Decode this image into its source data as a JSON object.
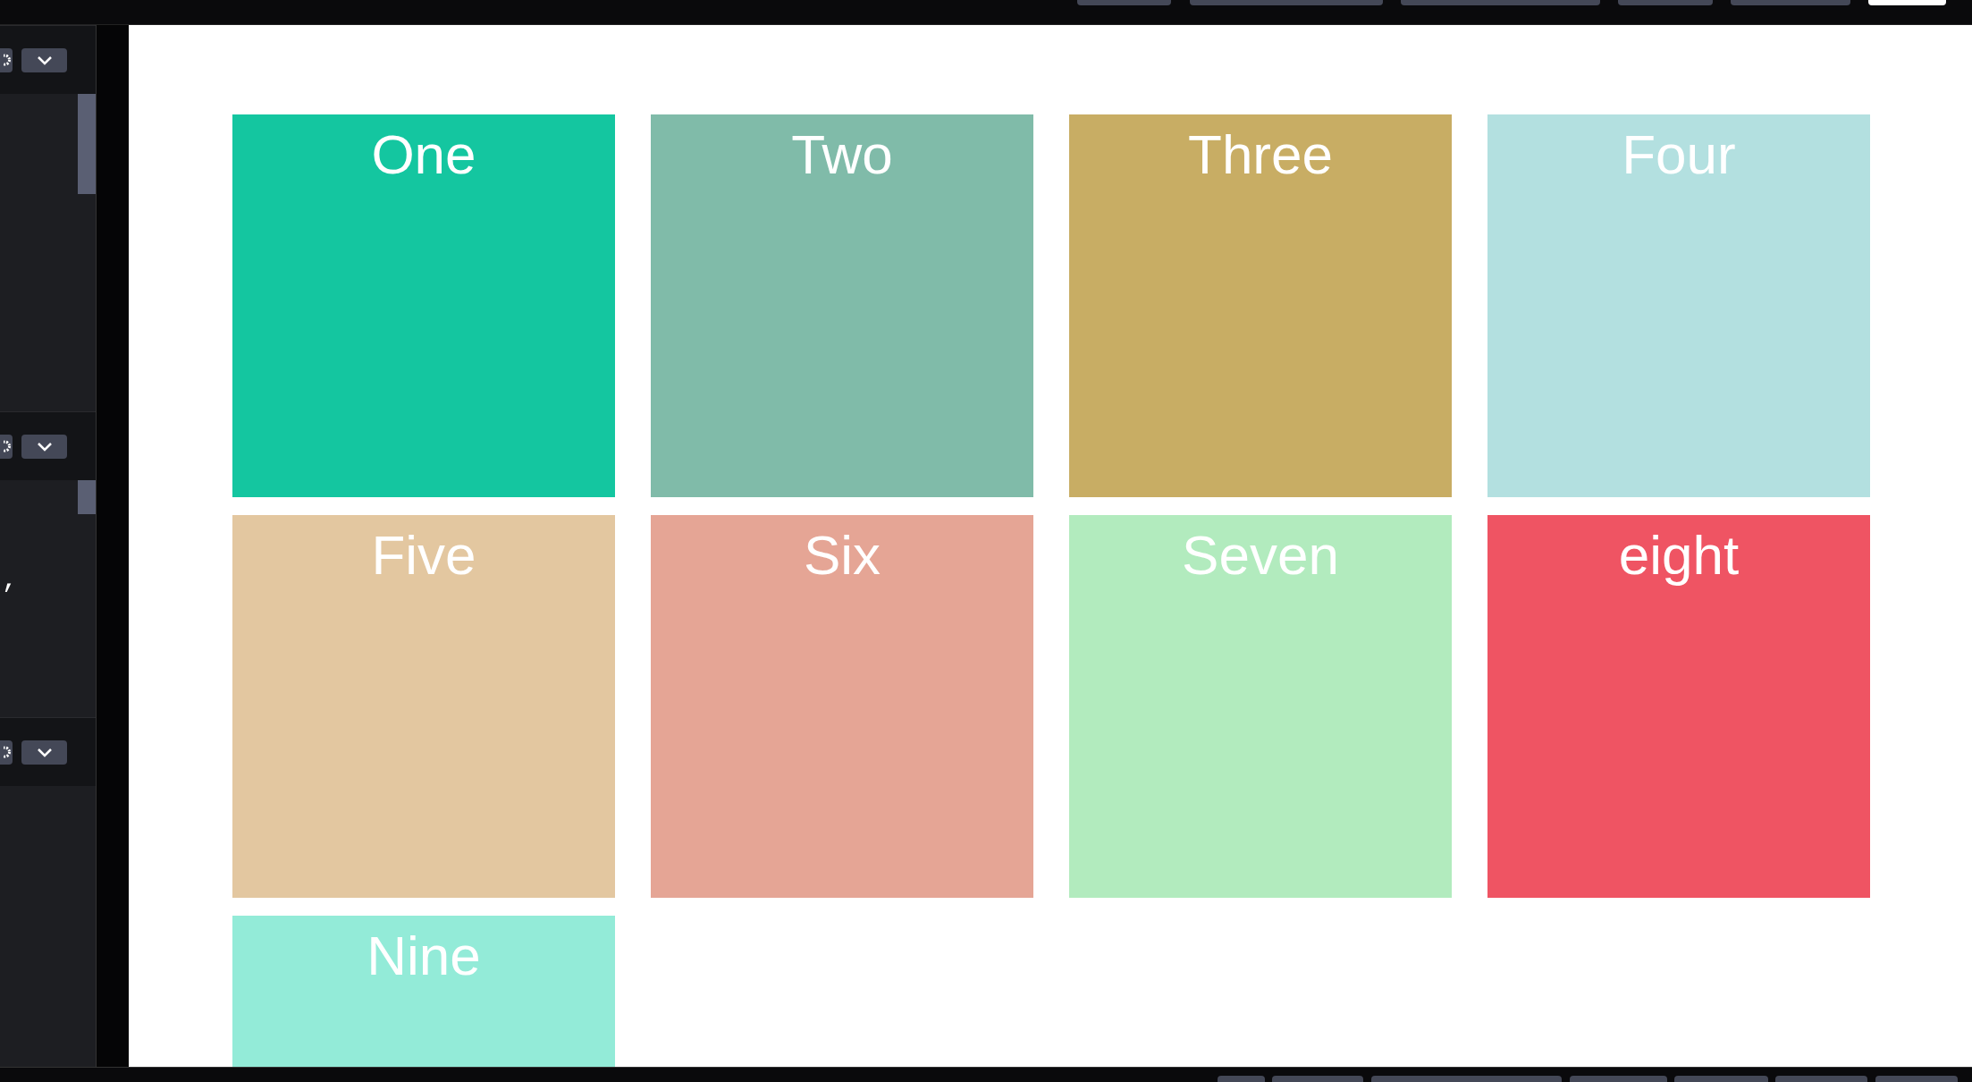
{
  "middle_editor": {
    "code": ","
  },
  "preview": {
    "cards": [
      {
        "label": "One",
        "color": "#14c6a0"
      },
      {
        "label": "Two",
        "color": "#80bba9"
      },
      {
        "label": "Three",
        "color": "#c8ad64"
      },
      {
        "label": "Four",
        "color": "#b3e0e0"
      },
      {
        "label": "Five",
        "color": "#e3c7a0"
      },
      {
        "label": "Six",
        "color": "#e5a595"
      },
      {
        "label": "Seven",
        "color": "#b2ebbe"
      },
      {
        "label": "eight",
        "color": "#ef5463"
      },
      {
        "label": "Nine",
        "color": "#93ebd8"
      }
    ]
  }
}
